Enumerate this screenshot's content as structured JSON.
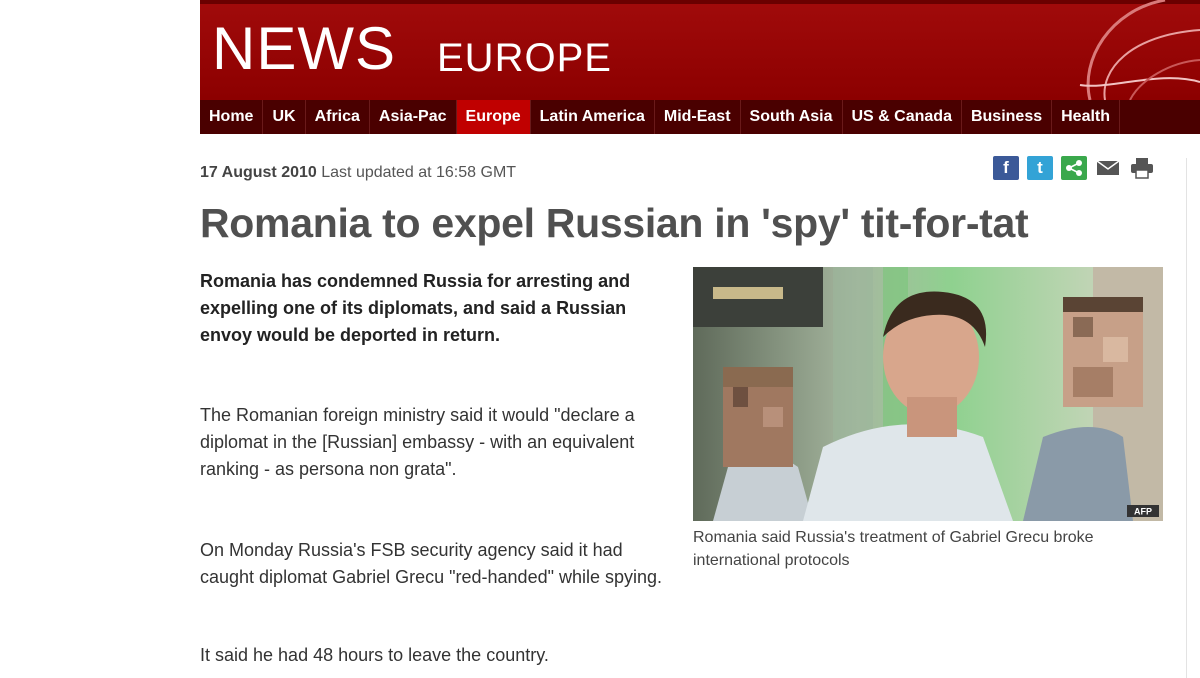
{
  "header": {
    "logo": "NEWS",
    "section": "EUROPE"
  },
  "nav": {
    "items": [
      "Home",
      "UK",
      "Africa",
      "Asia-Pac",
      "Europe",
      "Latin America",
      "Mid-East",
      "South Asia",
      "US & Canada",
      "Business",
      "Health"
    ],
    "active": "Europe"
  },
  "article": {
    "date": "17 August 2010",
    "updated": "Last updated at 16:58 GMT",
    "headline": "Romania to expel Russian in 'spy' tit-for-tat",
    "intro": "Romania has condemned Russia for arresting and expelling one of its diplomats, and said a Russian envoy would be deported in return.",
    "paragraphs": [
      "The Romanian foreign ministry said it would \"declare a diplomat in the [Russian] embassy - with an equivalent ranking - as persona non grata\".",
      "On Monday Russia's FSB security agency said it had caught diplomat Gabriel Grecu \"red-handed\" while spying.",
      "It said he had 48 hours to leave the country."
    ],
    "photo_credit": "AFP",
    "caption": "Romania said Russia's treatment of Gabriel Grecu broke international protocols"
  },
  "share": {
    "icons": [
      "facebook-icon",
      "twitter-icon",
      "share-icon",
      "email-icon",
      "print-icon"
    ],
    "facebook_glyph": "f",
    "twitter_glyph": "t"
  },
  "colors": {
    "banner": "#8c0000",
    "nav_bg": "#4a0000",
    "nav_active": "#c00000"
  }
}
